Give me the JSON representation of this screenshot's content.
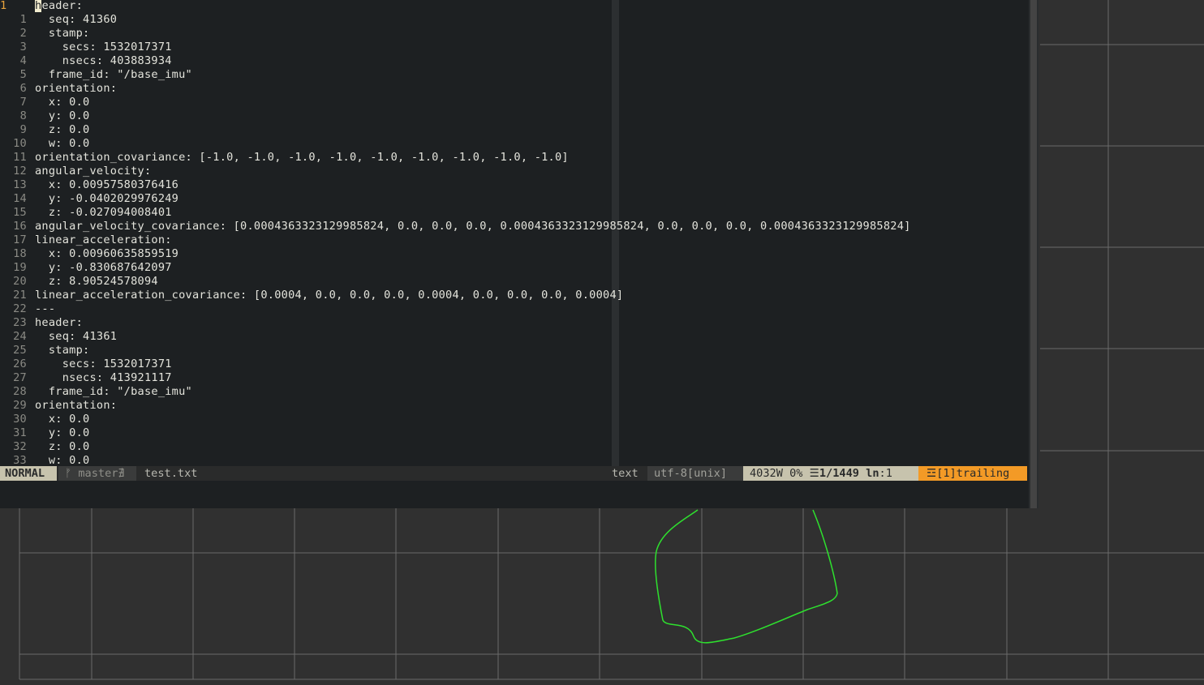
{
  "colors": {
    "editor_bg": "#1d2022",
    "text": "#e4e4dc",
    "line_number": "#8a8a84",
    "current_line_number": "#e8a33c",
    "mode_bg": "#c7c3ad",
    "warning_bg": "#f39a26",
    "viewer_grid": "#6a6a6a",
    "viewer_path": "#2ee02e"
  },
  "editor": {
    "lines": [
      {
        "n": "1",
        "text": "header:",
        "current": true
      },
      {
        "n": "1",
        "text": "  seq: 41360"
      },
      {
        "n": "2",
        "text": "  stamp:"
      },
      {
        "n": "3",
        "text": "    secs: 1532017371"
      },
      {
        "n": "4",
        "text": "    nsecs: 403883934"
      },
      {
        "n": "5",
        "text": "  frame_id: \"/base_imu\""
      },
      {
        "n": "6",
        "text": "orientation:"
      },
      {
        "n": "7",
        "text": "  x: 0.0"
      },
      {
        "n": "8",
        "text": "  y: 0.0"
      },
      {
        "n": "9",
        "text": "  z: 0.0"
      },
      {
        "n": "10",
        "text": "  w: 0.0"
      },
      {
        "n": "11",
        "text": "orientation_covariance: [-1.0, -1.0, -1.0, -1.0, -1.0, -1.0, -1.0, -1.0, -1.0]"
      },
      {
        "n": "12",
        "text": "angular_velocity:"
      },
      {
        "n": "13",
        "text": "  x: 0.00957580376416"
      },
      {
        "n": "14",
        "text": "  y: -0.0402029976249"
      },
      {
        "n": "15",
        "text": "  z: -0.027094008401"
      },
      {
        "n": "16",
        "text": "angular_velocity_covariance: [0.0004363323129985824, 0.0, 0.0, 0.0, 0.0004363323129985824, 0.0, 0.0, 0.0, 0.0004363323129985824]"
      },
      {
        "n": "17",
        "text": "linear_acceleration:"
      },
      {
        "n": "18",
        "text": "  x: 0.00960635859519"
      },
      {
        "n": "19",
        "text": "  y: -0.830687642097"
      },
      {
        "n": "20",
        "text": "  z: 8.90524578094"
      },
      {
        "n": "21",
        "text": "linear_acceleration_covariance: [0.0004, 0.0, 0.0, 0.0, 0.0004, 0.0, 0.0, 0.0, 0.0004]"
      },
      {
        "n": "22",
        "text": "---"
      },
      {
        "n": "23",
        "text": "header:"
      },
      {
        "n": "24",
        "text": "  seq: 41361"
      },
      {
        "n": "25",
        "text": "  stamp:"
      },
      {
        "n": "26",
        "text": "    secs: 1532017371"
      },
      {
        "n": "27",
        "text": "    nsecs: 413921117"
      },
      {
        "n": "28",
        "text": "  frame_id: \"/base_imu\""
      },
      {
        "n": "29",
        "text": "orientation:"
      },
      {
        "n": "30",
        "text": "  x: 0.0"
      },
      {
        "n": "31",
        "text": "  y: 0.0"
      },
      {
        "n": "32",
        "text": "  z: 0.0"
      },
      {
        "n": "33",
        "text": "  w: 0.0"
      }
    ]
  },
  "status": {
    "mode": "NORMAL",
    "branch": "ᚠ master∄",
    "filename": "test.txt",
    "filetype": "text",
    "encoding": "utf-8[unix]",
    "words": "4032W 0%",
    "position_icon": "☰",
    "position": "1/1449",
    "line_label": "ln",
    "column": ":1",
    "warning_icon": "☲",
    "warning": "[1]trailing"
  }
}
